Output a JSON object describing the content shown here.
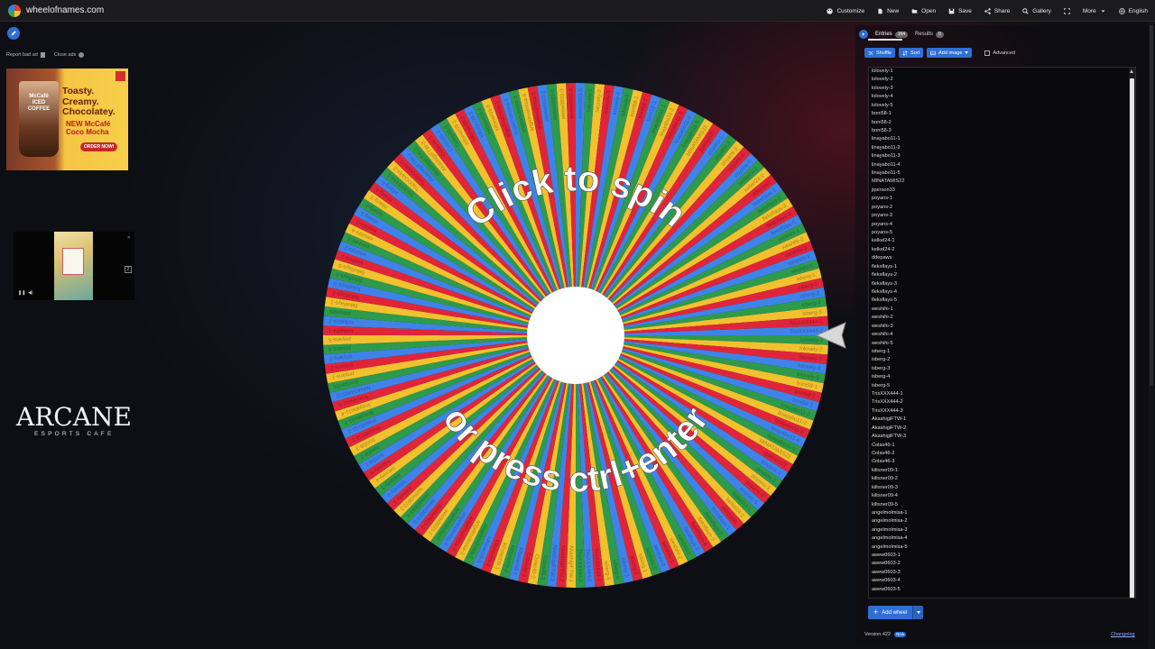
{
  "app": {
    "title": "wheelofnames.com"
  },
  "menu": [
    {
      "label": "Customize",
      "icon": "palette-icon"
    },
    {
      "label": "New",
      "icon": "new-file-icon"
    },
    {
      "label": "Open",
      "icon": "folder-icon"
    },
    {
      "label": "Save",
      "icon": "save-icon"
    },
    {
      "label": "Share",
      "icon": "share-icon"
    },
    {
      "label": "Gallery",
      "icon": "search-icon"
    },
    {
      "label": "",
      "icon": "fullscreen-icon"
    },
    {
      "label": "More",
      "icon": "chevron-down-icon"
    },
    {
      "label": "English",
      "icon": "globe-icon"
    }
  ],
  "ads": {
    "report_label": "Report bad ad",
    "close_label": "Close ads",
    "banner": {
      "brand": "McCafé ICED COFFEE",
      "headline": "Toasty. Creamy. Chocolatey.",
      "product": "NEW McCafé Coco Mocha",
      "cta": "ORDER NOW!"
    },
    "video_counter": "2"
  },
  "sponsor": {
    "name": "ARCANE",
    "tagline": "ESPORTS CAFE"
  },
  "wheel": {
    "top_text": "Click to spin",
    "bottom_text": "or press ctrl+enter",
    "segment_colors": [
      "#2e9a4b",
      "#f2c12e",
      "#e0253a",
      "#3f83e8"
    ],
    "label_colors": [
      "#1f6e34",
      "#a8821a",
      "#9e1424",
      "#2a5db0"
    ]
  },
  "panel": {
    "tabs": [
      {
        "label": "Entries",
        "count": "164"
      },
      {
        "label": "Results",
        "count": "0"
      }
    ],
    "tools": {
      "shuffle": "Shuffle",
      "sort": "Sort",
      "add_image": "Add image",
      "advanced": "Advanced"
    },
    "entries": [
      "lolovely-1",
      "lolovely-2",
      "lolovely-3",
      "lolovely-4",
      "lolovely-5",
      "boni58-1",
      "boni58-2",
      "boni58-3",
      "linayabo11-1",
      "linayabo11-2",
      "linayabo11-3",
      "linayabo11-4",
      "linayabo11-5",
      "MINATAMIS22",
      "jiperson33",
      "poyans-1",
      "poyans-2",
      "poyans-3",
      "poyans-4",
      "poyans-5",
      "kelkel24-1",
      "kelkel24-2",
      "ddepaws",
      "fleksflays-1",
      "fleksflays-2",
      "fleksflays-3",
      "fleksflays-4",
      "fleksflays-5",
      "weshihi-1",
      "weshihi-2",
      "weshihi-3",
      "weshihi-4",
      "weshihi-5",
      "isberg-1",
      "isberg-2",
      "isberg-3",
      "isberg-4",
      "isberg-5",
      "TrisXXX444-1",
      "TrisXXX444-2",
      "TrisXXX444-3",
      "AkashigiFTW-1",
      "AkashigiFTW-2",
      "AkashigiFTW-3",
      "Colas46-1",
      "Colas46-2",
      "Colas46-3",
      "kiltsner09-1",
      "kiltsner09-2",
      "kiltsner09-3",
      "kiltsner09-4",
      "kiltsner09-5",
      "angelmolmisa-1",
      "angelmolmisa-2",
      "angelmolmisa-3",
      "angelmolmisa-4",
      "angelmolmisa-5",
      "awew0603-1",
      "awew0603-2",
      "awew0603-3",
      "awew0603-4",
      "awew0603-5"
    ],
    "add_wheel_label": "Add wheel"
  },
  "footer": {
    "version": "Version 422",
    "version_badge": "New",
    "changelog": "Changelog"
  }
}
